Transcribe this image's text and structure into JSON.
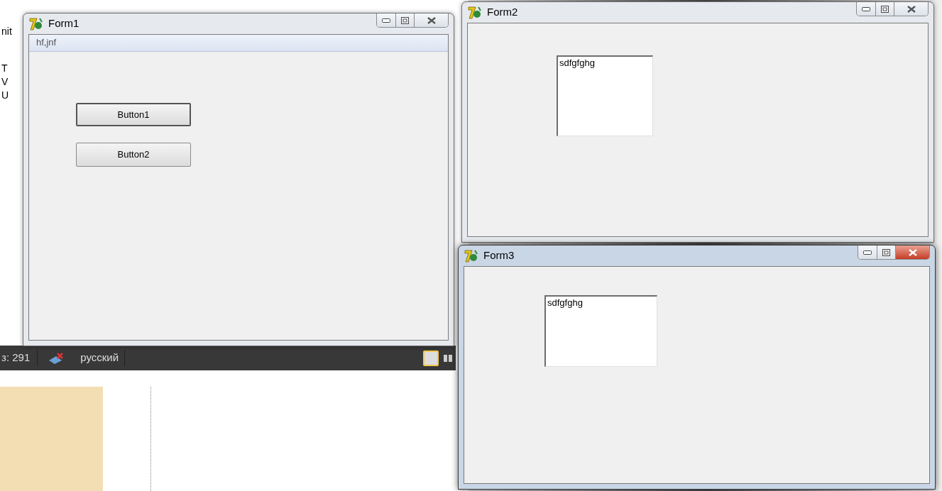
{
  "background_document": {
    "left_fragments": [
      "nit",
      "T",
      "V",
      "U"
    ],
    "status_bar": {
      "word_count": "з: 291",
      "language": "русский"
    }
  },
  "windows": [
    {
      "title": "Form1",
      "active": false,
      "controls": [
        {
          "kind": "panel",
          "text": "hf,jnf"
        },
        {
          "kind": "button",
          "text": "Button1",
          "focused": true
        },
        {
          "kind": "button",
          "text": "Button2",
          "focused": false
        }
      ]
    },
    {
      "title": "Form2",
      "active": false,
      "controls": [
        {
          "kind": "memo",
          "text": "sdfgfghg"
        }
      ]
    },
    {
      "title": "Form3",
      "active": true,
      "controls": [
        {
          "kind": "memo",
          "text": "sdfgfghg"
        }
      ]
    }
  ]
}
